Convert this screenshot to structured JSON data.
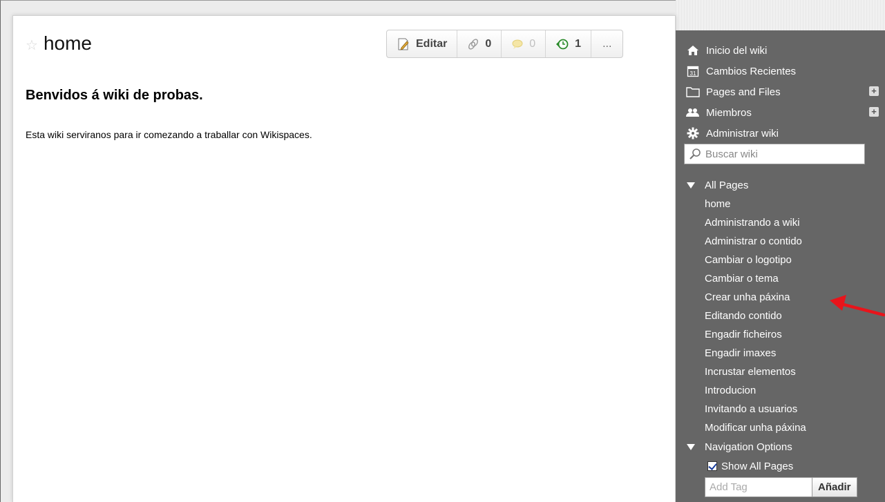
{
  "page": {
    "title": "home",
    "heading": "Benvidos á wiki de probas.",
    "text": "Esta wiki serviranos para ir comezando a traballar con Wikispaces."
  },
  "toolbar": {
    "edit_label": "Editar",
    "links_count": "0",
    "comments_count": "0",
    "history_count": "1",
    "more_label": "..."
  },
  "sidebar": {
    "nav": [
      {
        "label": "Inicio del wiki",
        "icon": "home-icon"
      },
      {
        "label": "Cambios Recientes",
        "icon": "calendar-icon"
      },
      {
        "label": "Pages and Files",
        "icon": "folder-icon",
        "plus": "+"
      },
      {
        "label": "Miembros",
        "icon": "members-icon",
        "plus": "+"
      },
      {
        "label": "Administrar wiki",
        "icon": "gear-icon"
      }
    ],
    "search_placeholder": "Buscar wiki",
    "all_pages_label": "All Pages",
    "pages": [
      "home",
      "Administrando a wiki",
      "Administrar o contido",
      "Cambiar o logotipo",
      "Cambiar o tema",
      "Crear unha páxina",
      "Editando contido",
      "Engadir ficheiros",
      "Engadir imaxes",
      "Incrustar elementos",
      "Introducion",
      "Invitando a usuarios",
      "Modificar unha páxina"
    ],
    "nav_options_label": "Navigation Options",
    "show_all_label": "Show All Pages",
    "tag_placeholder": "Add Tag",
    "tag_button": "Añadir"
  },
  "colors": {
    "sidebar_bg": "#666666",
    "arrow": "#e8141b"
  }
}
